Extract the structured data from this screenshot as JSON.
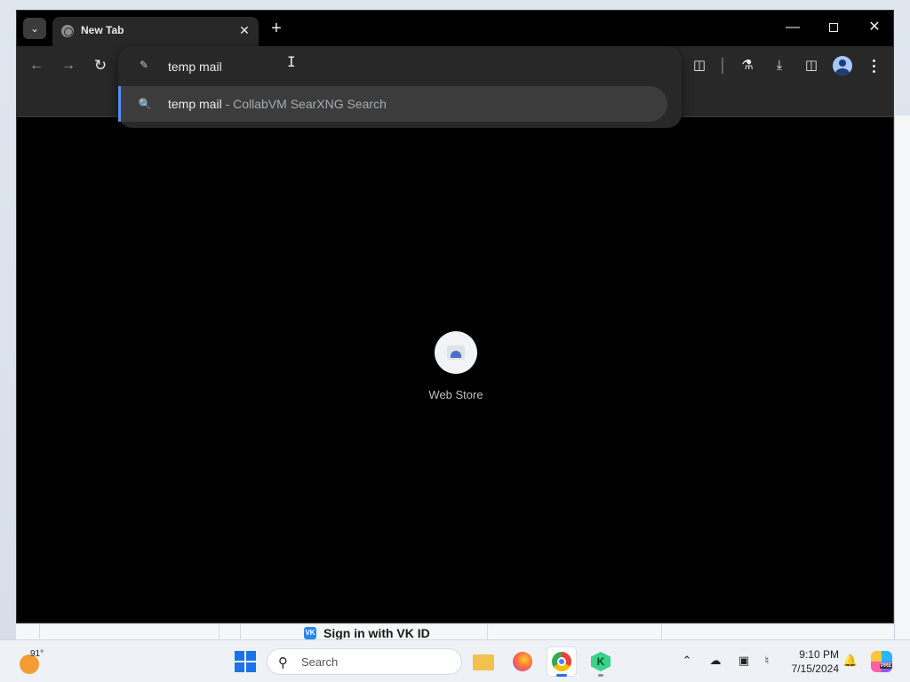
{
  "browser": {
    "tab": {
      "title": "New Tab"
    },
    "omnibox": {
      "value": "temp mail",
      "suggestion": {
        "query": "temp mail",
        "separator": " - ",
        "source": "CollabVM SearXNG Search"
      }
    },
    "new_tab_page": {
      "shortcuts": [
        {
          "label": "Web Store",
          "icon": "web-store-icon"
        }
      ]
    }
  },
  "behind_page": {
    "vk_button_label": "Sign in with VK ID"
  },
  "taskbar": {
    "weather_temp": "91°",
    "search_label": "Search",
    "time": "9:10 PM",
    "date": "7/15/2024",
    "apps": [
      "file-explorer-icon",
      "firefox-icon",
      "chrome-icon",
      "kaspersky-icon"
    ],
    "copilot_badge": "PRE"
  },
  "colors": {
    "accent": "#5b8def",
    "toolbar": "#282828",
    "suggestion_bg": "#3c3c3c"
  }
}
